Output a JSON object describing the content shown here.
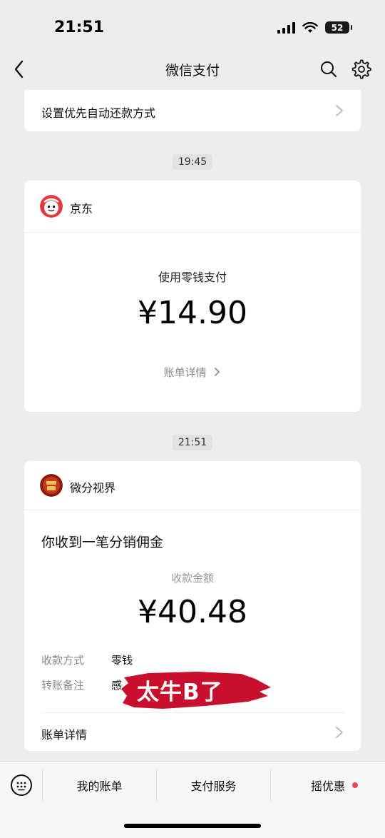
{
  "status_bar": {
    "time": "21:51",
    "battery": "52"
  },
  "nav": {
    "title": "微信支付"
  },
  "top_card": {
    "label": "设置优先自动还款方式"
  },
  "messages": [
    {
      "time": "19:45",
      "merchant": "京东",
      "pay_method": "使用零钱支付",
      "amount": "¥14.90",
      "detail_link": "账单详情"
    },
    {
      "time": "21:51",
      "merchant": "微分视界",
      "title": "你收到一笔分销佣金",
      "amount_label": "收款金额",
      "amount": "¥40.48",
      "fields": [
        {
          "key": "收款方式",
          "value": "零钱"
        },
        {
          "key": "转账备注",
          "value": "感"
        }
      ],
      "detail_link": "账单详情"
    }
  ],
  "overlay": {
    "text": "太牛B了",
    "color": "#c8102e"
  },
  "bottom_bar": {
    "tabs": [
      "我的账单",
      "支付服务",
      "摇优惠"
    ]
  },
  "colors": {
    "background": "#ededed",
    "card": "#ffffff",
    "badge_red": "#e84a4a"
  }
}
